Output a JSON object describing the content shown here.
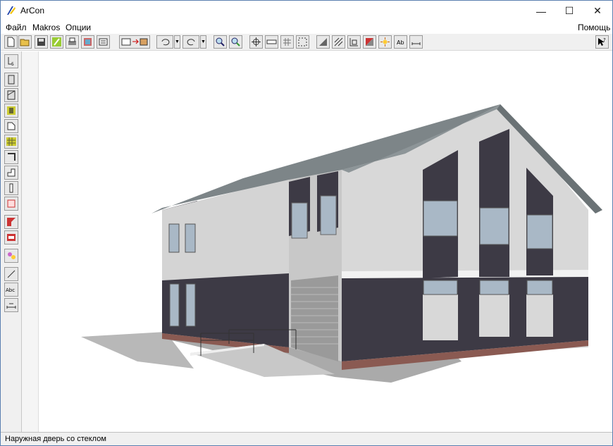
{
  "window": {
    "title": "ArCon",
    "minimize_glyph": "—",
    "maximize_glyph": "☐",
    "close_glyph": "✕"
  },
  "menu": {
    "file": "Файл",
    "makros": "Makros",
    "options": "Опции",
    "help": "Помощь"
  },
  "toolbar": {
    "buttons": [
      "new-document-icon",
      "open-folder-icon",
      "save-icon",
      "pencil-icon",
      "print-icon",
      "print-preview-icon",
      "export-icon",
      "copy-to-3d-icon",
      "undo-icon",
      "redo-icon",
      "zoom-icon",
      "zoom-walk-icon",
      "crosshair-icon",
      "ruler-icon",
      "grid-icon",
      "snap-grid-icon",
      "fill-wall-icon",
      "hatch-icon",
      "dimension-icon",
      "red-wall-icon",
      "light-icon",
      "text-style-icon",
      "measure-icon",
      "help-cursor-icon"
    ]
  },
  "left_toolbar": {
    "buttons": [
      "select-icon",
      "wall-icon",
      "wall-window-icon",
      "door-icon",
      "room-icon",
      "stairs-icon",
      "column-icon",
      "support-icon",
      "info-icon",
      "object-icon",
      "roof-icon",
      "dormer-icon",
      "paint-icon",
      "line-icon",
      "text-icon",
      "dimension-icon"
    ]
  },
  "statusbar": {
    "text": "Наружная дверь со стеклом"
  },
  "colors": {
    "roof": "#7d8588",
    "stucco": "#d6d6d6",
    "dark_panel": "#3d3a45",
    "plinth": "#8a5a52",
    "window_glass": "#a9b8c6"
  }
}
